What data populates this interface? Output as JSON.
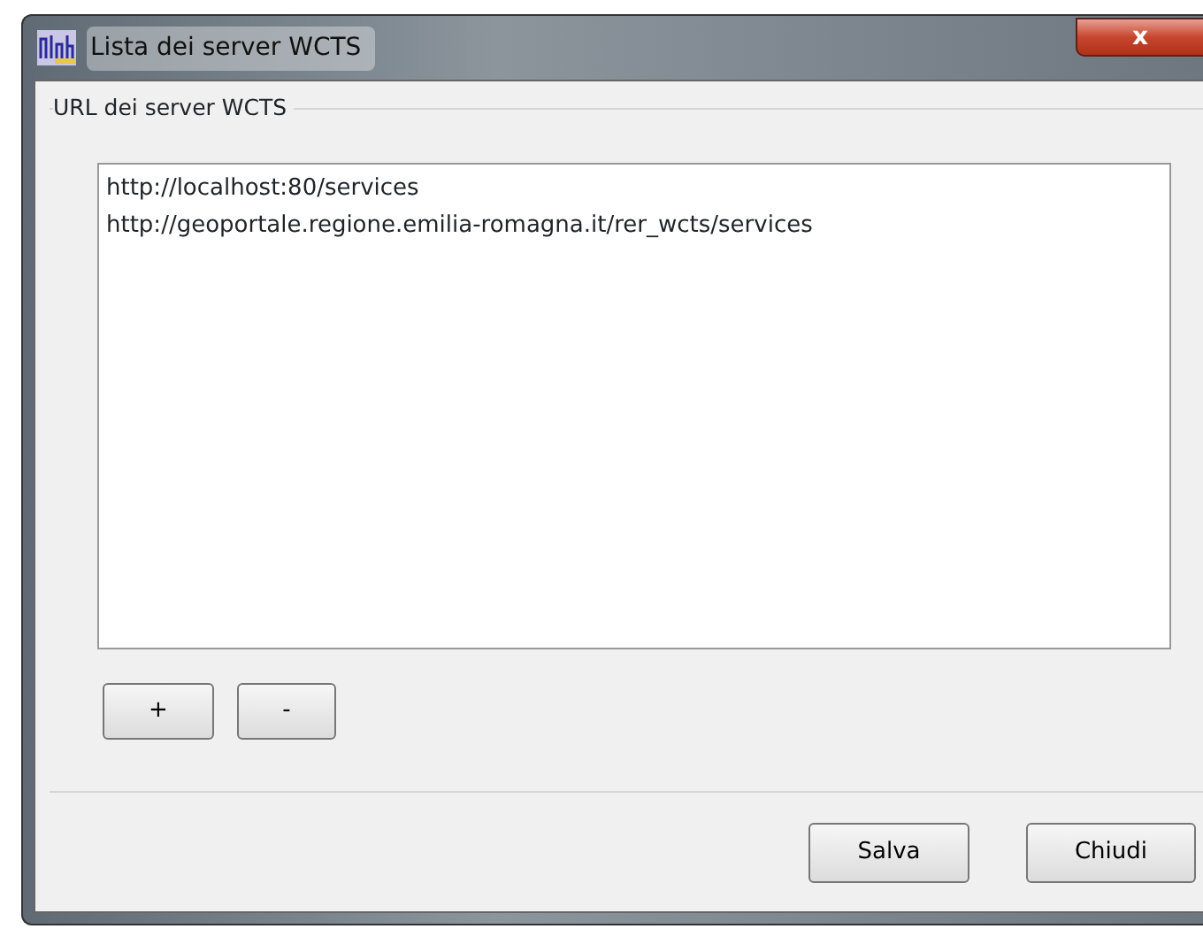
{
  "window": {
    "title": "Lista dei server WCTS",
    "close_label": "x"
  },
  "group": {
    "title": "URL dei server WCTS",
    "items": [
      "http://localhost:80/services",
      "http://geoportale.regione.emilia-romagna.it/rer_wcts/services"
    ],
    "buttons": [
      "+",
      "-"
    ]
  },
  "footer_buttons": [
    "Salva",
    "Chiudi"
  ]
}
